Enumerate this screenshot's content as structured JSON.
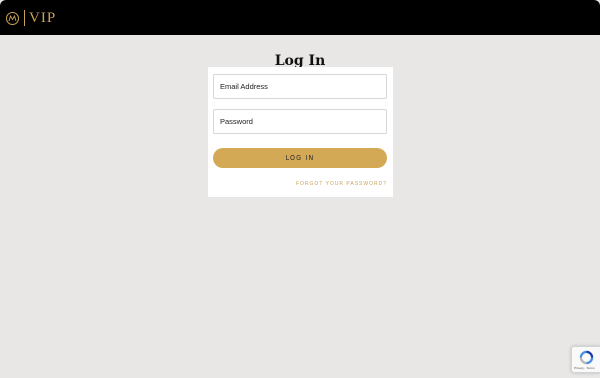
{
  "header": {
    "brand_text": "VIP",
    "logo_icon": "brand-monogram-icon",
    "colors": {
      "background": "#000000",
      "gold": "#c9a25a"
    }
  },
  "page": {
    "title": "Log In",
    "background": "#e8e7e6"
  },
  "form": {
    "email_placeholder": "Email Address",
    "password_placeholder": "Password",
    "email_value": "",
    "password_value": "",
    "submit_label": "LOG IN",
    "forgot_link": "FORGOT YOUR PASSWORD?",
    "button_color": "#d4a955"
  },
  "recaptcha": {
    "icon": "recaptcha-icon",
    "text": "Privacy - Terms"
  }
}
